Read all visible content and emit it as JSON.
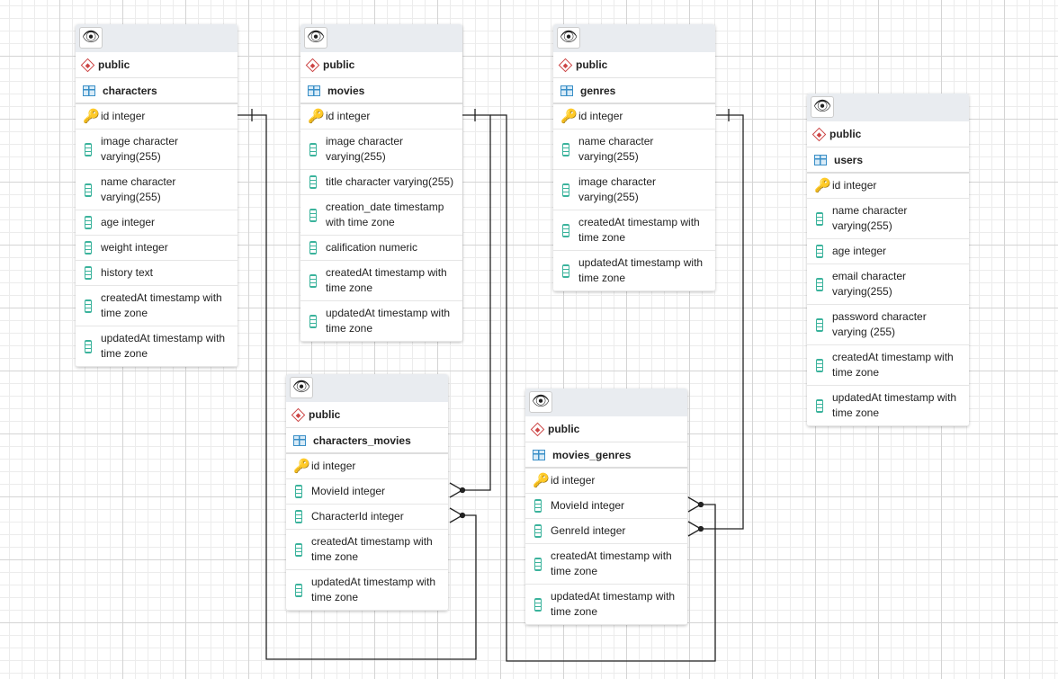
{
  "tables": [
    {
      "id": "characters",
      "schema": "public",
      "name": "characters",
      "columns": [
        {
          "text": "id integer",
          "pk": true
        },
        {
          "text": "image character varying(255)"
        },
        {
          "text": "name character varying(255)"
        },
        {
          "text": "age integer"
        },
        {
          "text": "weight integer"
        },
        {
          "text": "history text"
        },
        {
          "text": "createdAt timestamp with time zone"
        },
        {
          "text": "updatedAt timestamp with time zone"
        }
      ]
    },
    {
      "id": "movies",
      "schema": "public",
      "name": "movies",
      "columns": [
        {
          "text": "id integer",
          "pk": true
        },
        {
          "text": "image character varying(255)"
        },
        {
          "text": "title character varying(255)"
        },
        {
          "text": "creation_date timestamp with time zone"
        },
        {
          "text": "calification numeric"
        },
        {
          "text": "createdAt timestamp with time zone"
        },
        {
          "text": "updatedAt timestamp with time zone"
        }
      ]
    },
    {
      "id": "genres",
      "schema": "public",
      "name": "genres",
      "columns": [
        {
          "text": "id integer",
          "pk": true
        },
        {
          "text": "name character varying(255)"
        },
        {
          "text": "image character varying(255)"
        },
        {
          "text": "createdAt timestamp with time zone"
        },
        {
          "text": "updatedAt timestamp with time zone"
        }
      ]
    },
    {
      "id": "users",
      "schema": "public",
      "name": "users",
      "columns": [
        {
          "text": "id integer",
          "pk": true
        },
        {
          "text": "name character varying(255)"
        },
        {
          "text": "age integer"
        },
        {
          "text": "email character varying(255)"
        },
        {
          "text": "password character varying (255)"
        },
        {
          "text": "createdAt timestamp with time zone"
        },
        {
          "text": "updatedAt timestamp with time zone"
        }
      ]
    },
    {
      "id": "characters_movies",
      "schema": "public",
      "name": "characters_movies",
      "columns": [
        {
          "text": "id integer",
          "pk": true
        },
        {
          "text": "MovieId integer"
        },
        {
          "text": "CharacterId integer"
        },
        {
          "text": "createdAt timestamp with time zone"
        },
        {
          "text": "updatedAt timestamp with time zone"
        }
      ]
    },
    {
      "id": "movies_genres",
      "schema": "public",
      "name": "movies_genres",
      "columns": [
        {
          "text": "id integer",
          "pk": true
        },
        {
          "text": "MovieId integer"
        },
        {
          "text": "GenreId integer"
        },
        {
          "text": "createdAt timestamp with time zone"
        },
        {
          "text": "updatedAt timestamp with time zone"
        }
      ]
    }
  ],
  "relations": [
    {
      "from": "characters.id",
      "to": "characters_movies.CharacterId",
      "type": "one-to-many"
    },
    {
      "from": "movies.id",
      "to": "characters_movies.MovieId",
      "type": "one-to-many"
    },
    {
      "from": "movies.id",
      "to": "movies_genres.MovieId",
      "type": "one-to-many"
    },
    {
      "from": "genres.id",
      "to": "movies_genres.GenreId",
      "type": "one-to-many"
    }
  ]
}
